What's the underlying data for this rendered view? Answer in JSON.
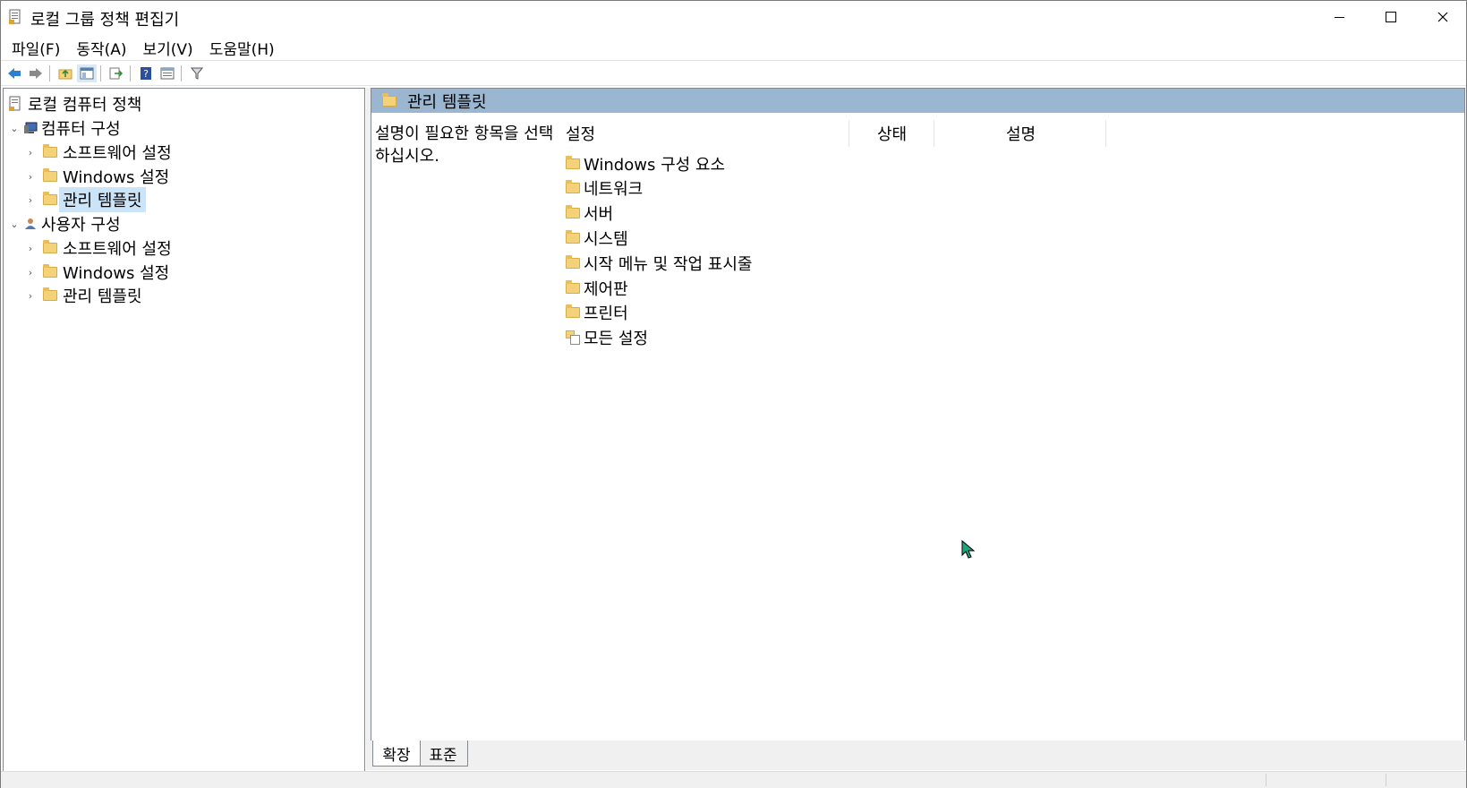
{
  "window": {
    "title": "로컬 그룹 정책 편집기"
  },
  "menu": [
    "파일(F)",
    "동작(A)",
    "보기(V)",
    "도움말(H)"
  ],
  "toolbar": [
    "back-icon",
    "forward-icon",
    "up-folder-icon",
    "show-hide-tree-icon",
    "export-list-icon",
    "help-icon",
    "properties-icon",
    "filter-icon"
  ],
  "tree": {
    "root": "로컬 컴퓨터 정책",
    "computer": {
      "label": "컴퓨터 구성",
      "children": [
        "소프트웨어 설정",
        "Windows 설정",
        "관리 템플릿"
      ]
    },
    "user": {
      "label": "사용자 구성",
      "children": [
        "소프트웨어 설정",
        "Windows 설정",
        "관리 템플릿"
      ]
    },
    "selected": "관리 템플릿"
  },
  "right": {
    "header": "관리 템플릿",
    "description": "설명이 필요한 항목을 선택하십시오.",
    "columns": [
      "설정",
      "상태",
      "설명"
    ],
    "items": [
      "Windows 구성 요소",
      "네트워크",
      "서버",
      "시스템",
      "시작 메뉴 및 작업 표시줄",
      "제어판",
      "프린터",
      "모든 설정"
    ]
  },
  "tabs": [
    "확장",
    "표준"
  ],
  "colors": {
    "header_bg": "#9ab6d1",
    "selection": "#cce4f7",
    "folder": "#f3d27a"
  }
}
